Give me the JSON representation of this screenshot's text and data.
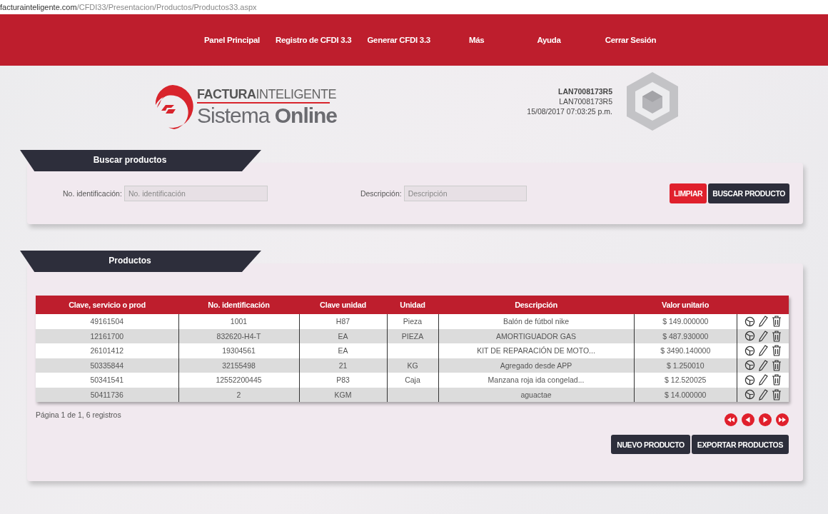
{
  "address_bar": {
    "domain": "facturainteligente.com",
    "path": "/CFDI33/Presentacion/Productos/Productos33.aspx"
  },
  "nav": [
    "Panel Principal",
    "Registro de CFDI 3.3",
    "Generar CFDI 3.3",
    "Más",
    "Ayuda",
    "Cerrar Sesión"
  ],
  "logo": {
    "brand_bold": "FACTURA",
    "brand_light": "INTELIGENTE",
    "sub_light": "Sistema",
    "sub_bold": "Online"
  },
  "user": {
    "rfc": "LAN7008173R5",
    "name": "LAN7008173R5",
    "datetime": "15/08/2017 07:03:25 p.m."
  },
  "search": {
    "title": "Buscar productos",
    "fields": [
      {
        "label": "No. identificación:",
        "placeholder": "No. identificación"
      },
      {
        "label": "Descripción:",
        "placeholder": "Descripción"
      }
    ],
    "buttons": [
      {
        "label": "LIMPIAR",
        "kind": "danger"
      },
      {
        "label": "BUSCAR PRODUCTO",
        "kind": "dark"
      }
    ]
  },
  "products": {
    "title": "Productos",
    "columns": [
      "Clave, servicio o prod",
      "No. identificación",
      "Clave unidad",
      "Unidad",
      "Descripción",
      "Valor unitario"
    ],
    "rows": [
      {
        "cells": [
          "49161504",
          "1001",
          "H87",
          "Pieza",
          "Balón de fútbol nike",
          "$ 149.000000"
        ]
      },
      {
        "cells": [
          "12161700",
          "832620-H4-T",
          "EA",
          "PIEZA",
          "AMORTIGUADOR GAS",
          "$ 487.930000"
        ]
      },
      {
        "cells": [
          "26101412",
          "19304561",
          "EA",
          null,
          "KIT DE REPARACIÓN DE MOTO...",
          "$ 3490.140000"
        ]
      },
      {
        "cells": [
          "50335844",
          "32155498",
          "21",
          "KG",
          "Agregado desde APP",
          "$ 1.250010"
        ]
      },
      {
        "cells": [
          "50341541",
          "12552200445",
          "P83",
          "Caja",
          "Manzana roja ida congelad...",
          "$ 12.520025"
        ]
      },
      {
        "cells": [
          "50411736",
          "2",
          "KGM",
          null,
          "aguactae",
          "$ 14.000000"
        ]
      }
    ],
    "pager_text": "Página 1 de 1, 6 registros",
    "buttons": [
      "NUEVO PRODUCTO",
      "EXPORTAR PRODUCTOS"
    ]
  }
}
